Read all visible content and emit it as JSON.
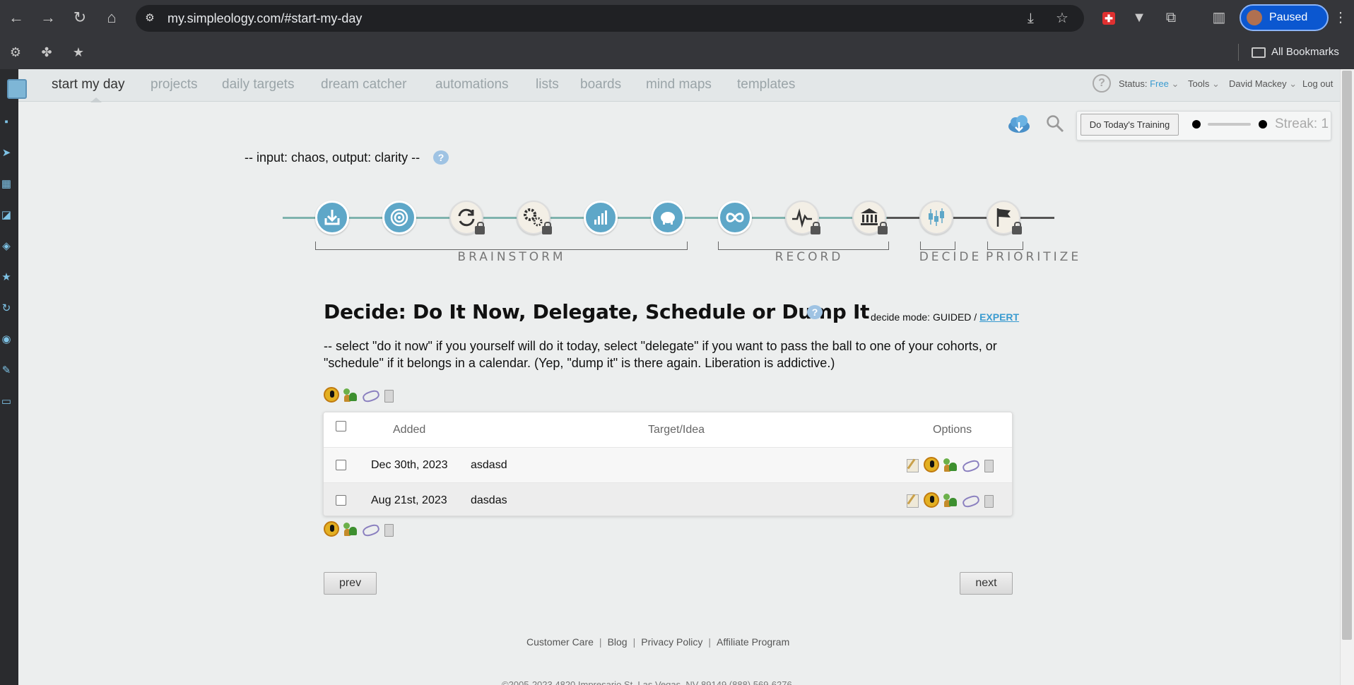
{
  "browser": {
    "url": "my.simpleology.com/#start-my-day",
    "profile_label": "Paused",
    "all_bookmarks_label": "All Bookmarks"
  },
  "nav": {
    "items": [
      "start my day",
      "projects",
      "daily targets",
      "dream catcher",
      "automations",
      "lists",
      "boards",
      "mind maps",
      "templates"
    ],
    "status_label": "Status:",
    "status_value": "Free",
    "tools_label": "Tools",
    "user_label": "David Mackey",
    "logout_label": "Log out"
  },
  "toolbar": {
    "training_button": "Do Today's Training",
    "streak": "Streak: 1"
  },
  "tagline": "-- input: chaos, output: clarity --",
  "steps": {
    "icons": [
      "inbox-download-icon",
      "target-icon",
      "sync-cycle-icon",
      "gears-icon",
      "bar-chart-icon",
      "piggy-bank-icon",
      "infinity-loop-icon",
      "heartbeat-icon",
      "bank-building-icon",
      "candlestick-icon",
      "flag-icon"
    ],
    "groups": [
      "BRAINSTORM",
      "RECORD",
      "DECIDE",
      "PRIORITIZE"
    ]
  },
  "decide": {
    "title": "Decide: Do It Now, Delegate, Schedule or Dump It",
    "mode_label": "decide mode: GUIDED /",
    "mode_link": "EXPERT",
    "description": "-- select \"do it now\" if you yourself will do it today, select \"delegate\" if you want to pass the ball to one of your cohorts, or \"schedule\" if it belongs in a calendar. (Yep, \"dump it\" is there again. Liberation is addictive.)"
  },
  "table": {
    "headers": [
      "Added",
      "Target/Idea",
      "Options"
    ],
    "rows": [
      {
        "added": "Dec 30th, 2023",
        "target": "asdasd"
      },
      {
        "added": "Aug 21st, 2023",
        "target": "dasdas"
      }
    ]
  },
  "buttons": {
    "prev": "prev",
    "next": "next"
  },
  "footer": {
    "links": [
      "Customer Care",
      "Blog",
      "Privacy Policy",
      "Affiliate Program"
    ],
    "copyright": "©2005-2023 4820 Impresario St, Las Vegas, NV 89149 (888) 569-6276"
  },
  "colors": {
    "accent": "#5ea7c8",
    "status_free": "#3a9bd0"
  }
}
